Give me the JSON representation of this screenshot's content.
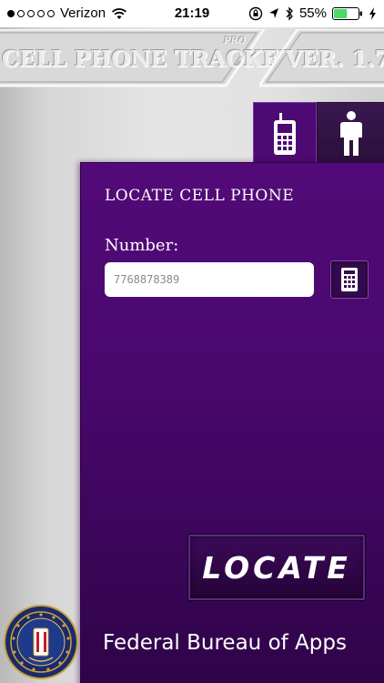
{
  "status_bar": {
    "carrier": "Verizon",
    "time": "21:19",
    "battery_percent": "55%",
    "signal_bars_filled": 1,
    "signal_bars_total": 5,
    "battery_level": 0.55
  },
  "header": {
    "title": "CELL PHONE TRACKER",
    "edition": "PRO",
    "version": "VER. 1.7"
  },
  "tabs": [
    {
      "icon": "cell-phone-icon",
      "active": true
    },
    {
      "icon": "person-icon",
      "active": false
    }
  ],
  "locate_form": {
    "heading": "LOCATE CELL PHONE",
    "number_label": "Number:",
    "number_value": "7768878389",
    "contacts_icon": "keypad-icon",
    "locate_label": "LOCATE"
  },
  "footer": {
    "text": "Federal Bureau of Apps",
    "seal_icon": "agency-seal-icon"
  },
  "colors": {
    "panel": "#4d0a72",
    "panel_dark": "#2f0448",
    "banner": "#d8d8d8",
    "battery": "#4cd964"
  }
}
